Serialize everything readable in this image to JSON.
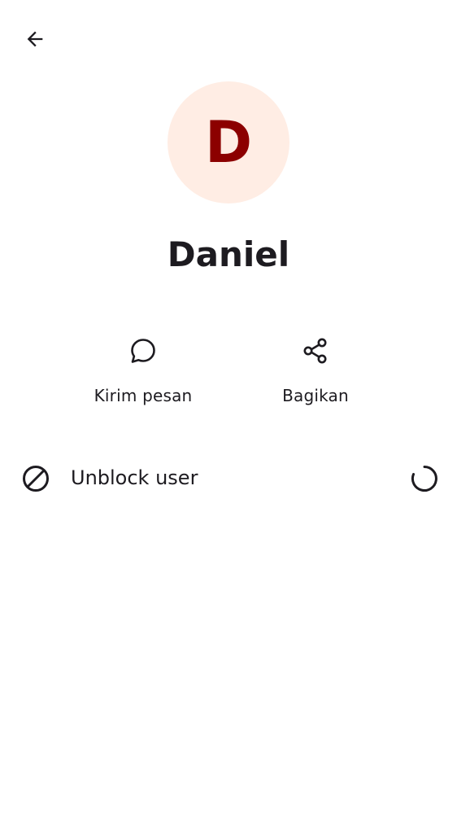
{
  "header": {
    "back_icon": "arrow-left-icon"
  },
  "profile": {
    "avatar_letter": "D",
    "name": "Daniel",
    "avatar_bg": "#ffede4",
    "avatar_fg": "#8c0000"
  },
  "actions": [
    {
      "label": "Kirim pesan",
      "icon": "chat-bubble-icon"
    },
    {
      "label": "Bagikan",
      "icon": "share-icon"
    }
  ],
  "list": {
    "unblock_label": "Unblock user",
    "unblock_icon": "block-icon",
    "status_icon": "loading-spinner-icon"
  }
}
